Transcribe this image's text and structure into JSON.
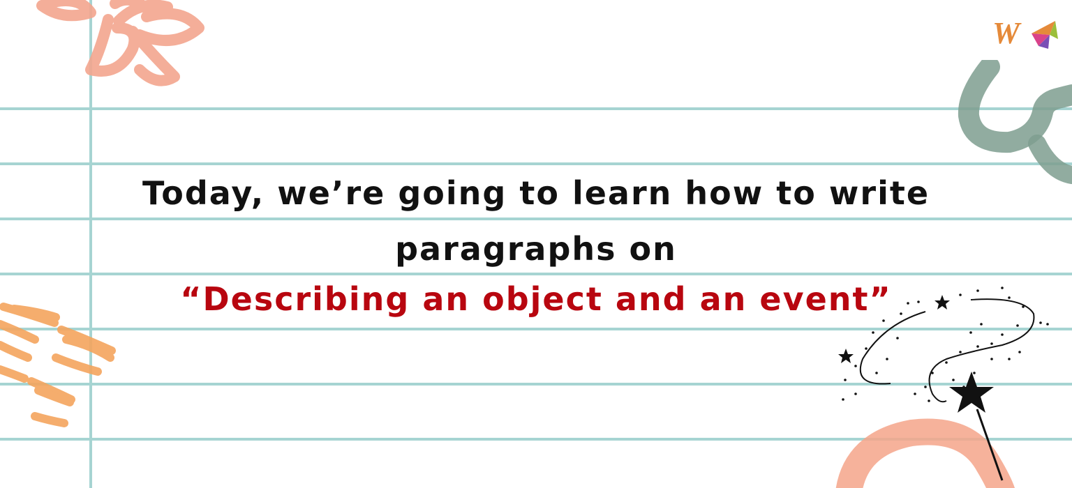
{
  "headline": {
    "line1": "Today, we’re going to learn how to write",
    "line2": "paragraphs on",
    "line3": "“Describing an object and an event”"
  },
  "logo": {
    "letter": "W"
  },
  "colors": {
    "rule_lines": "#a6d4d2",
    "headline_text": "#111111",
    "highlight_text": "#b8060f",
    "flower_salmon": "#f3a68f",
    "brush_green": "#7e9e8f",
    "strokes_orange": "#f4a55e",
    "blob_salmon": "#f5a48a",
    "logo_orange": "#e58a3a",
    "logo_pink": "#d9428a",
    "logo_purple": "#7a4fb5",
    "logo_green": "#9bbf3a"
  },
  "icons": [
    "flower-doodle-icon",
    "brush-swirl-icon",
    "brush-strokes-icon",
    "magic-wand-icon",
    "brush-blob-icon",
    "brand-logo-icon"
  ]
}
